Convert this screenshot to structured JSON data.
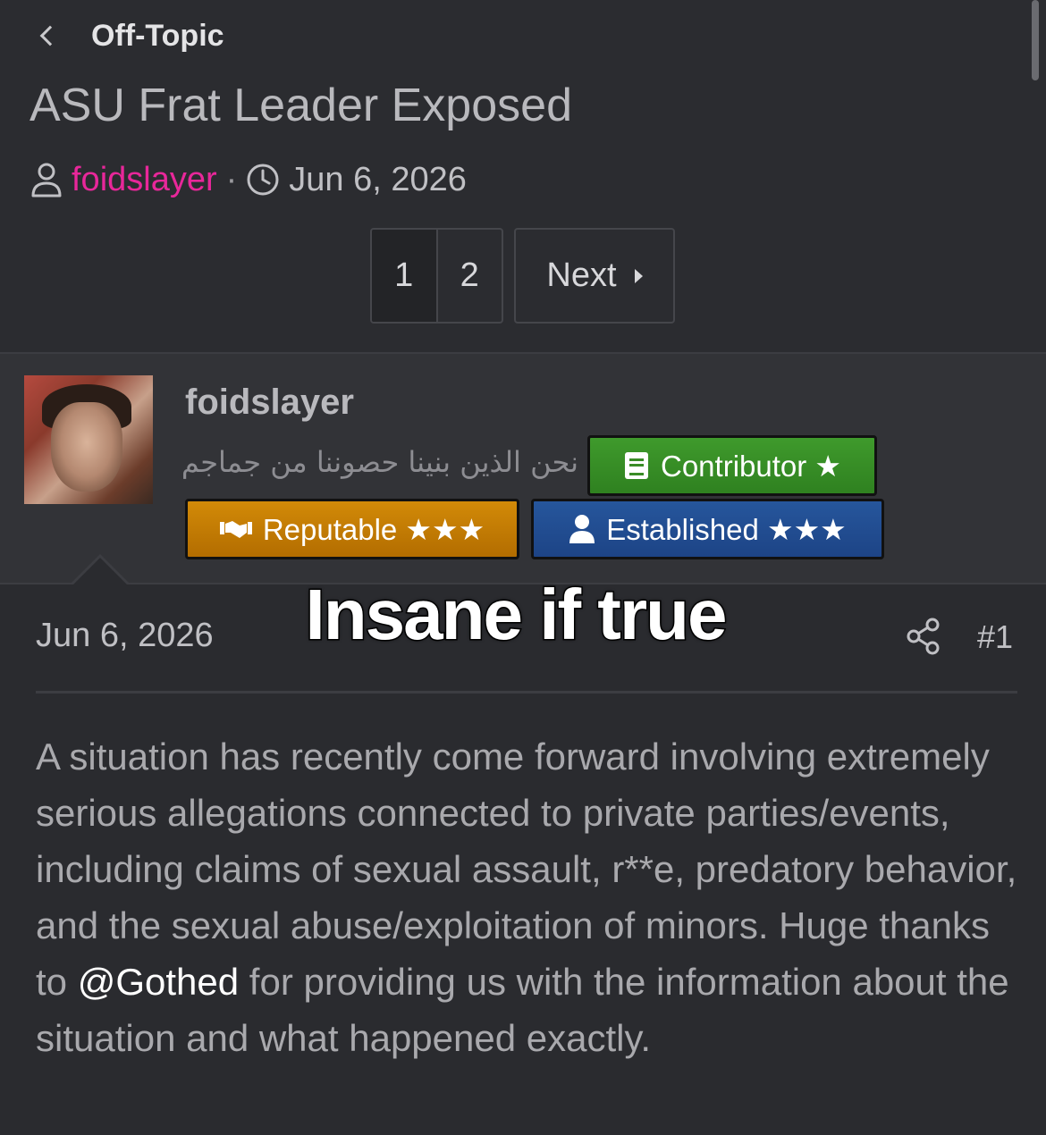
{
  "breadcrumb": {
    "label": "Off-Topic",
    "back_icon": "chevron-left-icon"
  },
  "thread": {
    "title": "ASU Frat Leader Exposed",
    "author": "foidslayer",
    "separator": "·",
    "date": "Jun 6, 2026"
  },
  "pagination": {
    "pages": [
      "1",
      "2"
    ],
    "current": "1",
    "next_label": "Next"
  },
  "post": {
    "username": "foidslayer",
    "signature": "نحن الذين بنينا حصوننا من جماجم",
    "badges": {
      "contributor": "Contributor ★",
      "reputable": "Reputable ★★★",
      "established": "Established ★★★"
    },
    "date": "Jun 6, 2026",
    "number": "#1",
    "body_before": "A situation has recently come forward involving extremely serious allegations connected to private parties/events, including claims of sexual assault, r**e, predatory behavior, and the sexual abuse/exploitation of minors. Huge thanks to ",
    "mention": "@Gothed",
    "body_after": " for providing us with the information about the situation and what happened exactly."
  },
  "overlay_caption": "Insane if true",
  "colors": {
    "background": "#2a2b2f",
    "author_link": "#e8279a",
    "contributor_badge": "#3f9a2c",
    "reputable_badge": "#d28a08",
    "established_badge": "#26569c"
  }
}
